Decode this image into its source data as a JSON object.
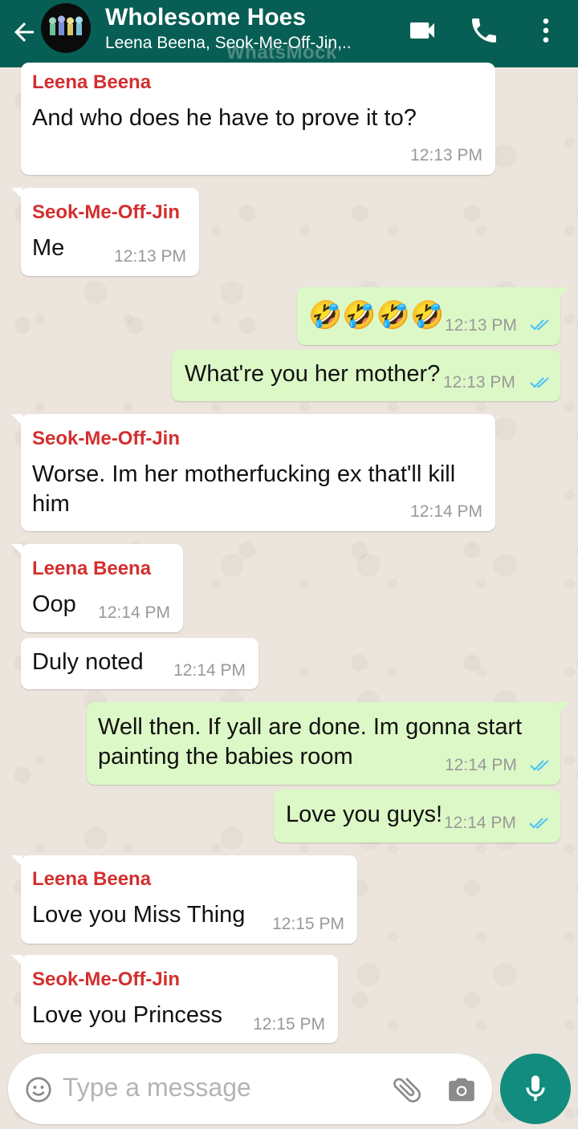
{
  "header": {
    "title": "Wholesome Hoes",
    "subtitle": "Leena Beena, Seok-Me-Off-Jin,..",
    "watermark": "WhatsMock"
  },
  "messages": [
    {
      "sender": "Leena Beena",
      "text": "And who does he have to prove it to?",
      "time": "12:13 PM"
    },
    {
      "sender": "Seok-Me-Off-Jin",
      "text": "Me",
      "time": "12:13 PM"
    },
    {
      "text": "🤣🤣🤣🤣",
      "time": "12:13 PM",
      "status": "read"
    },
    {
      "text": "What're you her mother?",
      "time": "12:13 PM",
      "status": "read"
    },
    {
      "sender": "Seok-Me-Off-Jin",
      "text_line1": "Worse. Im her motherfucking ex that'll kill",
      "text_line2": "him",
      "time": "12:14 PM"
    },
    {
      "sender": "Leena Beena",
      "text": "Oop",
      "time": "12:14 PM"
    },
    {
      "text": "Duly noted",
      "time": "12:14 PM"
    },
    {
      "text_line1": "Well then. If yall are done. Im gonna start",
      "text_line2": "painting the babies room",
      "time": "12:14 PM",
      "status": "read"
    },
    {
      "text": "Love you guys!",
      "time": "12:14 PM",
      "status": "read"
    },
    {
      "sender": "Leena Beena",
      "text": "Love you Miss Thing",
      "time": "12:15 PM"
    },
    {
      "sender": "Seok-Me-Off-Jin",
      "text": "Love you Princess",
      "time": "12:15 PM"
    }
  ],
  "composer": {
    "placeholder": "Type a message"
  },
  "colors": {
    "header": "#075e54",
    "outgoing_bubble": "#dcf8c6",
    "incoming_bubble": "#ffffff",
    "sender_name": "#d32f2f",
    "read_check": "#4fc3f7",
    "mic_button": "#128c7e"
  },
  "icons": [
    "back-arrow-icon",
    "video-call-icon",
    "phone-icon",
    "more-vert-icon",
    "emoji-icon",
    "attach-icon",
    "camera-icon",
    "mic-icon",
    "double-check-icon"
  ]
}
